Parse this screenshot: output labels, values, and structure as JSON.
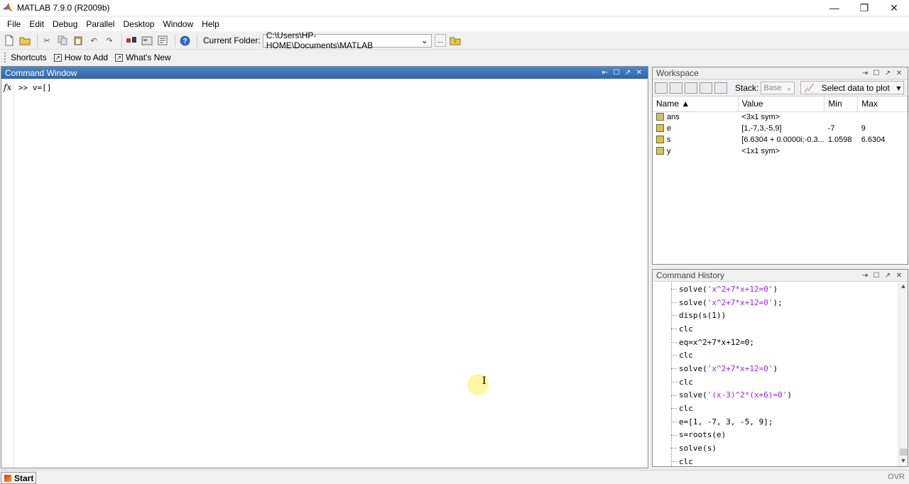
{
  "window": {
    "title": "MATLAB  7.9.0 (R2009b)",
    "minimize": "—",
    "restore": "❐",
    "close": "✕"
  },
  "menu": [
    "File",
    "Edit",
    "Debug",
    "Parallel",
    "Desktop",
    "Window",
    "Help"
  ],
  "toolbar": {
    "current_folder_label": "Current Folder:",
    "current_folder_value": "C:\\Users\\HP-HOME\\Documents\\MATLAB",
    "browse_label": "..."
  },
  "shortcuts": {
    "label": "Shortcuts",
    "how_to_add": "How to Add",
    "whats_new": "What's New"
  },
  "command_window": {
    "title": "Command Window",
    "fx": "fx",
    "prompt_line": ">>  v=[]"
  },
  "workspace": {
    "title": "Workspace",
    "stack_label": "Stack:",
    "stack_value": "Base",
    "plot_select": "Select data to plot",
    "columns": [
      "Name ▲",
      "Value",
      "Min",
      "Max"
    ],
    "rows": [
      {
        "name": "ans",
        "value": "<3x1 sym>",
        "min": "",
        "max": "",
        "icon": "sym-icon"
      },
      {
        "name": "e",
        "value": "[1,-7,3,-5,9]",
        "min": "-7",
        "max": "9",
        "icon": "matrix-icon"
      },
      {
        "name": "s",
        "value": "[6.6304 + 0.0000i;-0.3...",
        "min": "1.0598",
        "max": "6.6304",
        "icon": "matrix-icon"
      },
      {
        "name": "y",
        "value": "<1x1 sym>",
        "min": "",
        "max": "",
        "icon": "sym-icon"
      }
    ]
  },
  "history": {
    "title": "Command History",
    "lines": [
      {
        "pre": "solve(",
        "str": "'x^2+7*x+12=0'",
        "post": ")"
      },
      {
        "pre": "solve(",
        "str": "'x^2+7*x+12=0'",
        "post": ");"
      },
      {
        "pre": "disp(s(1))",
        "str": "",
        "post": ""
      },
      {
        "pre": "clc",
        "str": "",
        "post": ""
      },
      {
        "pre": "eq=x^2+7*x+12=0;",
        "str": "",
        "post": ""
      },
      {
        "pre": "clc",
        "str": "",
        "post": ""
      },
      {
        "pre": "solve(",
        "str": "'x^2+7*x+12=0'",
        "post": ")"
      },
      {
        "pre": "clc",
        "str": "",
        "post": ""
      },
      {
        "pre": "solve(",
        "str": "'(x-3)^2*(x+6)=0'",
        "post": ")"
      },
      {
        "pre": "clc",
        "str": "",
        "post": ""
      },
      {
        "pre": "e=[1, -7, 3, -5, 9];",
        "str": "",
        "post": ""
      },
      {
        "pre": "s=roots(e)",
        "str": "",
        "post": ""
      },
      {
        "pre": "solve(s)",
        "str": "",
        "post": ""
      },
      {
        "pre": "clc",
        "str": "",
        "post": ""
      }
    ]
  },
  "status": {
    "start": "Start",
    "ovr": "OVR"
  }
}
